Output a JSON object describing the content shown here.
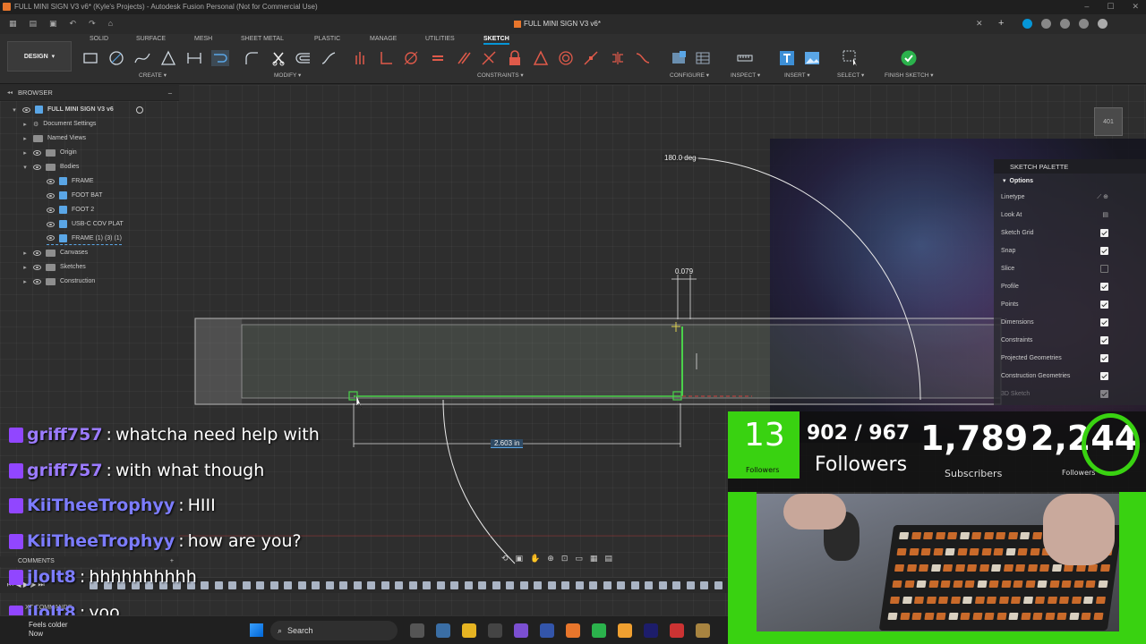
{
  "titlebar": {
    "title": "FULL MINI SIGN V3 v6* (Kyle's Projects) - Autodesk Fusion Personal (Not for Commercial Use)",
    "tab_title": "FULL MINI SIGN V3 v6*"
  },
  "toolbar": {
    "design_label": "DESIGN",
    "workspace_tabs": [
      "SOLID",
      "SURFACE",
      "MESH",
      "SHEET METAL",
      "PLASTIC",
      "MANAGE",
      "UTILITIES",
      "SKETCH"
    ],
    "active_tab": "SKETCH",
    "groups": {
      "create": "CREATE",
      "modify": "MODIFY",
      "constraints": "CONSTRAINTS",
      "configure": "CONFIGURE",
      "inspect": "INSPECT",
      "insert": "INSERT",
      "select": "SELECT",
      "finish": "FINISH SKETCH"
    }
  },
  "browser": {
    "header": "BROWSER",
    "root": "FULL MINI SIGN V3 v6",
    "items": [
      {
        "label": "Document Settings"
      },
      {
        "label": "Named Views"
      },
      {
        "label": "Origin"
      },
      {
        "label": "Bodies"
      },
      {
        "label": "FRAME"
      },
      {
        "label": "FOOT BAT"
      },
      {
        "label": "FOOT 2"
      },
      {
        "label": "USB-C COV PLAT"
      },
      {
        "label": "FRAME (1) (3) (1)"
      },
      {
        "label": "Canvases"
      },
      {
        "label": "Sketches"
      },
      {
        "label": "Construction"
      }
    ]
  },
  "sketch_palette": {
    "title": "SKETCH PALETTE",
    "section": "Options",
    "rows": [
      {
        "label": "Linetype",
        "checked": null
      },
      {
        "label": "Look At",
        "checked": null
      },
      {
        "label": "Sketch Grid",
        "checked": true
      },
      {
        "label": "Snap",
        "checked": true
      },
      {
        "label": "Slice",
        "checked": false
      },
      {
        "label": "Profile",
        "checked": true
      },
      {
        "label": "Points",
        "checked": true
      },
      {
        "label": "Dimensions",
        "checked": true
      },
      {
        "label": "Constraints",
        "checked": true
      },
      {
        "label": "Projected Geometries",
        "checked": true
      },
      {
        "label": "Construction Geometries",
        "checked": true
      },
      {
        "label": "3D Sketch",
        "checked": true
      }
    ]
  },
  "dimensions": {
    "angle": "180.0 deg",
    "small": "0.079",
    "length": "2.603 in"
  },
  "chat": [
    {
      "user": "griff757",
      "color": "#9b7bff",
      "message": "whatcha need help with"
    },
    {
      "user": "griff757",
      "color": "#9b7bff",
      "message": "with what though"
    },
    {
      "user": "KiiTheeTrophyy",
      "color": "#7c7cff",
      "message": "HIII"
    },
    {
      "user": "KiiTheeTrophyy",
      "color": "#7c7cff",
      "message": "how are you?"
    },
    {
      "user": "jlolt8",
      "color": "#7c7cff",
      "message": "hhhhhhhhhh"
    },
    {
      "user": "jlolt8",
      "color": "#7c7cff",
      "message": "yoo"
    }
  ],
  "comments_label": "COMMENTS",
  "text_commands_label": "XT COMMANDS",
  "stream_stats": {
    "green_count": "13",
    "green_label": "Followers",
    "goal": "902 / 967",
    "goal_label": "Followers",
    "subscribers": "1,789",
    "subscribers_label": "Subscribers",
    "followers": "2,244",
    "followers_label": "Followers"
  },
  "taskbar": {
    "weather_line1": "Feels colder",
    "weather_line2": "Now",
    "search_placeholder": "Search"
  },
  "viewcube_label": "401"
}
